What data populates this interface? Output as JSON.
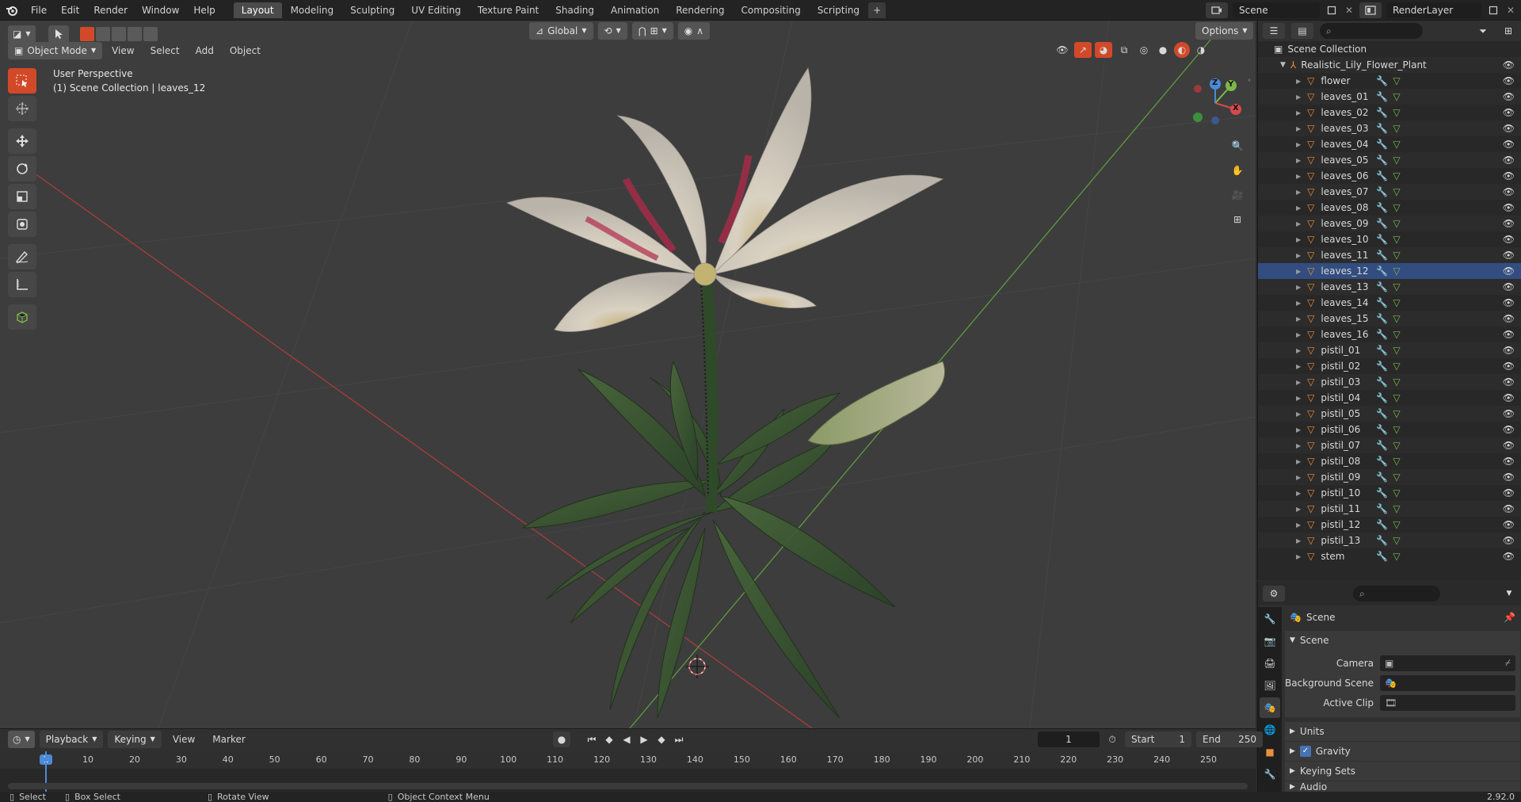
{
  "topbar": {
    "menus": [
      "File",
      "Edit",
      "Render",
      "Window",
      "Help"
    ],
    "workspaces": [
      "Layout",
      "Modeling",
      "Sculpting",
      "UV Editing",
      "Texture Paint",
      "Shading",
      "Animation",
      "Rendering",
      "Compositing",
      "Scripting"
    ],
    "active_workspace": "Layout",
    "add_tab": "+",
    "scene_name": "Scene",
    "render_layer": "RenderLayer"
  },
  "viewport_header": {
    "mode": "Object Mode",
    "menus": [
      "View",
      "Select",
      "Add",
      "Object"
    ],
    "transform_orientation": "Global",
    "options": "Options"
  },
  "viewport": {
    "perspective_label": "User Perspective",
    "context_label": "(1) Scene Collection | leaves_12",
    "gizmo_axes": {
      "x": "X",
      "y": "Y",
      "z": "Z"
    }
  },
  "outliner": {
    "root": "Scene Collection",
    "collection": "Realistic_Lily_Flower_Plant",
    "selected": "leaves_12",
    "items": [
      "flower",
      "leaves_01",
      "leaves_02",
      "leaves_03",
      "leaves_04",
      "leaves_05",
      "leaves_06",
      "leaves_07",
      "leaves_08",
      "leaves_09",
      "leaves_10",
      "leaves_11",
      "leaves_12",
      "leaves_13",
      "leaves_14",
      "leaves_15",
      "leaves_16",
      "pistil_01",
      "pistil_02",
      "pistil_03",
      "pistil_04",
      "pistil_05",
      "pistil_06",
      "pistil_07",
      "pistil_08",
      "pistil_09",
      "pistil_10",
      "pistil_11",
      "pistil_12",
      "pistil_13",
      "stem"
    ]
  },
  "properties": {
    "context": "Scene",
    "panel_title": "Scene",
    "fields": [
      {
        "label": "Camera"
      },
      {
        "label": "Background Scene"
      },
      {
        "label": "Active Clip"
      }
    ],
    "collapsed_panels": [
      "Units",
      "Gravity",
      "Keying Sets",
      "Audio"
    ],
    "gravity_checked": true
  },
  "timeline": {
    "menus": [
      "Playback",
      "Keying",
      "View",
      "Marker"
    ],
    "current_frame": "1",
    "start_label": "Start",
    "start_value": "1",
    "end_label": "End",
    "end_value": "250",
    "ruler": [
      "1",
      "10",
      "20",
      "30",
      "40",
      "50",
      "60",
      "70",
      "80",
      "90",
      "100",
      "110",
      "120",
      "130",
      "140",
      "150",
      "160",
      "170",
      "180",
      "190",
      "200",
      "210",
      "220",
      "230",
      "240",
      "250"
    ]
  },
  "statusbar": {
    "select": "Select",
    "box_select": "Box Select",
    "rotate_view": "Rotate View",
    "context_menu": "Object Context Menu",
    "version": "2.92.0"
  },
  "colors": {
    "accent_orange": "#d2492a",
    "selection_blue": "#334d80",
    "object_icon": "#e8913a",
    "axis_x": "#d84a4a",
    "axis_y": "#7cb84a",
    "axis_z": "#4a8bd8"
  }
}
